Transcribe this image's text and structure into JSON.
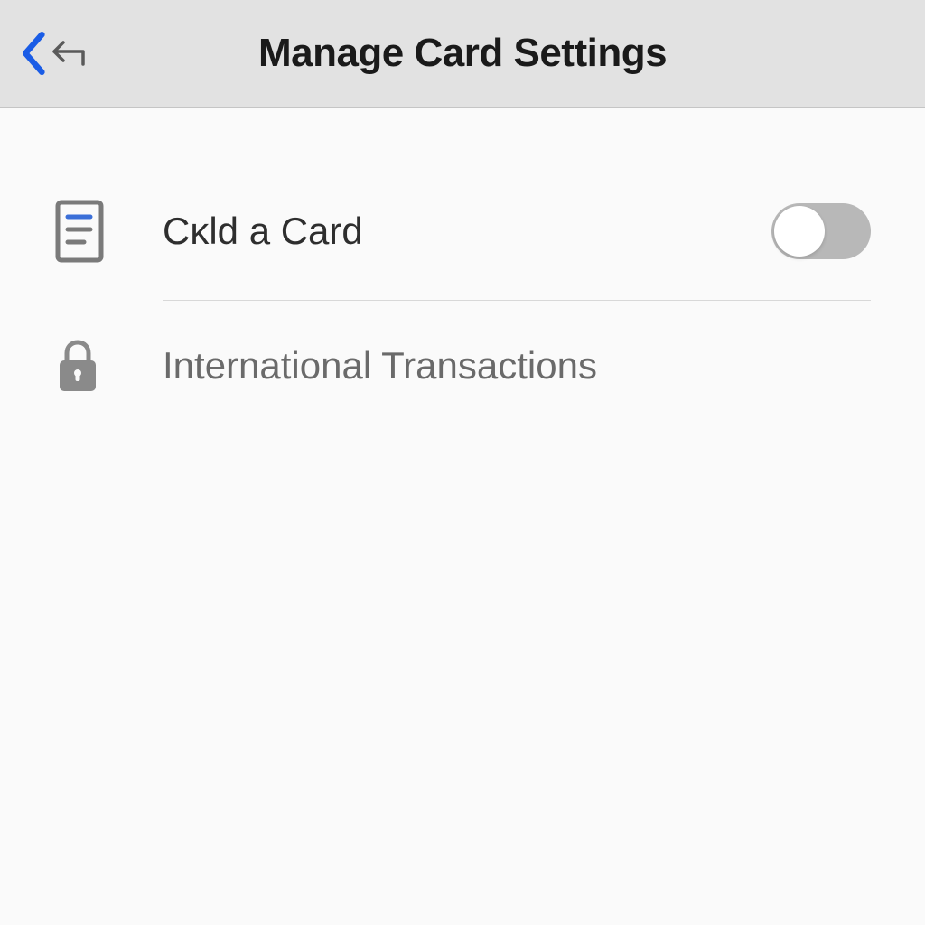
{
  "header": {
    "title": "Manage Card Settings"
  },
  "settings": {
    "item1": {
      "icon": "document-icon",
      "label": "Cĸld a Card",
      "hasToggle": true,
      "toggleState": "off"
    },
    "item2": {
      "icon": "lock-icon",
      "label": "International Transactions",
      "hasToggle": false
    }
  },
  "colors": {
    "accent": "#1a5ce6",
    "iconGray": "#8a8a8a",
    "textDark": "#2e2e2e",
    "textMedium": "#6a6a6a"
  }
}
